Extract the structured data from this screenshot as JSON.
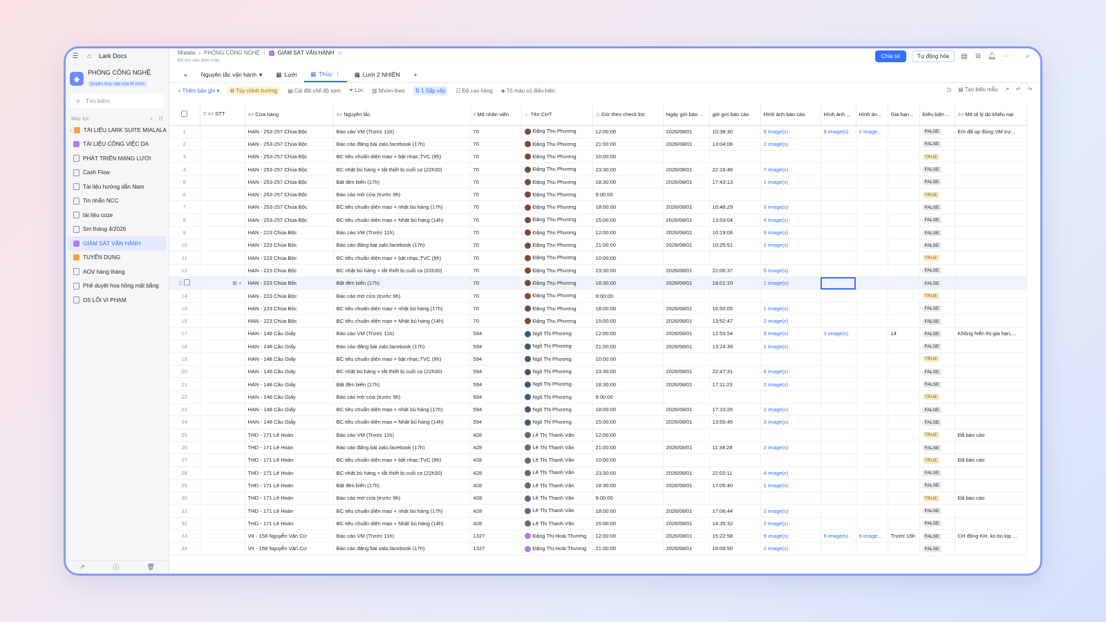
{
  "sidebar": {
    "home_label": "Lark Docs",
    "space_name": "PHÒNG CÔNG NGHỆ",
    "space_sub": "Quyền truy cập của tổ chức",
    "search_placeholder": "Tìm kiếm",
    "section_label": "Mục lục",
    "items": [
      {
        "label": "TÀI LIỆU LARK SUITE MIALALA",
        "kind": "sq",
        "color": "#f5a04a"
      },
      {
        "label": "TÀI LIỆU CÔNG VIỆC DA",
        "kind": "sq",
        "color": "#b47be8"
      },
      {
        "label": "PHÁT TRIỂN MẠNG LƯỚI",
        "kind": "doc"
      },
      {
        "label": "Cash Flow",
        "kind": "doc"
      },
      {
        "label": "Tài liệu hướng dẫn Nam",
        "kind": "doc"
      },
      {
        "label": "Tin nhắn NCC",
        "kind": "doc"
      },
      {
        "label": "tài liệu coze",
        "kind": "doc"
      },
      {
        "label": "Sm tháng 4/2026",
        "kind": "doc"
      },
      {
        "label": "GIÁM SÁT VẬN HÀNH",
        "kind": "sq",
        "color": "#b47be8",
        "active": true
      },
      {
        "label": "TUYỂN DỤNG",
        "kind": "sq",
        "color": "#f5a04a"
      },
      {
        "label": "AOV hàng tháng",
        "kind": "doc"
      },
      {
        "label": "Phê duyệt hoa hồng mặt bằng",
        "kind": "doc"
      },
      {
        "label": "DS LỖI VI PHẠM",
        "kind": "doc"
      }
    ]
  },
  "header": {
    "crumbs": [
      "Mialala",
      "PHÒNG CÔNG NGHỆ",
      "GIÁM SÁT VẬN HÀNH"
    ],
    "saved": "Đã lưu vào đám mây.",
    "share_label": "Chia sẻ",
    "automation_label": "Tự động hóa"
  },
  "tabs": [
    {
      "label": "Nguyên tắc vận hành"
    },
    {
      "label": "Lưới"
    },
    {
      "label": "Thủy",
      "active": true
    },
    {
      "label": "Lưới 2 NHIÊN"
    }
  ],
  "toolbar": {
    "add_record": "Thêm bản ghi",
    "customize": "Tùy chỉnh trường",
    "view_settings": "Cài đặt chế độ xem",
    "filter": "Lọc",
    "group": "Nhóm theo",
    "sort": "1 Sắp xếp",
    "row_height": "Độ cao hàng",
    "conditional_color": "Tô màu có điều kiện",
    "create_form": "Tạo biểu mẫu"
  },
  "columns": [
    "STT",
    "Cửa hàng",
    "Nguyên tắc",
    "Mã nhân viên",
    "Tên CHT",
    "Giờ theo check list",
    "Ngày gửi báo ...",
    "giờ gửi báo cáo",
    "Hình ảnh báo cáo.",
    "Hình ảnh ...",
    "Hình ản...",
    "Gia hạn...",
    "Điều kiện ...",
    "Mô tả lý do khiếu nại"
  ],
  "rows": [
    [
      "1",
      "HAN - 253-257 Chùa Bộc",
      "Báo cáo VM (Trước 11h)",
      "70",
      "Đặng Thu Phương",
      "12:00:00",
      "2026/08/01",
      "10:38:30",
      "9 image(s)",
      "9 image(s)",
      "2 image...",
      "",
      "FALSE",
      "Em đã up đúng VM trư..."
    ],
    [
      "2",
      "HAN - 253-257 Chùa Bộc",
      "Báo cáo đăng bài zalo,facebook (17h)",
      "70",
      "Đặng Thu Phương",
      "21:00:00",
      "2026/08/01",
      "13:04:06",
      "2 image(s)",
      "",
      "",
      "",
      "FALSE",
      ""
    ],
    [
      "3",
      "HAN - 253-257 Chùa Bộc",
      "BC tiêu chuẩn diện mạo + bật nhạc,TVC (9h)",
      "70",
      "Đặng Thu Phương",
      "10:00:00",
      "",
      "",
      "",
      "",
      "",
      "",
      "TRUE",
      ""
    ],
    [
      "4",
      "HAN - 253-257 Chùa Bộc",
      "BC nhặt bù hàng + tắt thiết bị cuối ca (22h30)",
      "70",
      "Đặng Thu Phương",
      "23:30:00",
      "2026/08/01",
      "22:16:46",
      "7 image(s)",
      "",
      "",
      "",
      "FALSE",
      ""
    ],
    [
      "5",
      "HAN - 253-257 Chùa Bộc",
      "Bật đèn biển (17h)",
      "70",
      "Đặng Thu Phương",
      "18:30:00",
      "2026/08/01",
      "17:43:13",
      "1 image(s)",
      "",
      "",
      "",
      "FALSE",
      ""
    ],
    [
      "6",
      "HAN - 253-257 Chùa Bộc",
      "Báo cáo mở cửa (trước 9h)",
      "70",
      "Đặng Thu Phương",
      "9:00:00",
      "",
      "",
      "",
      "",
      "",
      "",
      "TRUE",
      ""
    ],
    [
      "7",
      "HAN - 253-257 Chùa Bộc",
      "BC tiêu chuẩn diện mạo + nhặt bù hàng (17h)",
      "70",
      "Đặng Thu Phương",
      "18:00:00",
      "2026/08/01",
      "16:48:29",
      "3 image(s)",
      "",
      "",
      "",
      "FALSE",
      ""
    ],
    [
      "8",
      "HAN - 253-257 Chùa Bộc",
      "BC tiêu chuẩn diện mạo + Nhặt bù hàng (14h)",
      "70",
      "Đặng Thu Phương",
      "15:00:00",
      "2026/08/01",
      "13:53:04",
      "4 image(s)",
      "",
      "",
      "",
      "FALSE",
      ""
    ],
    [
      "9",
      "HAN - 223 Chùa Bộc",
      "Báo cáo VM (Trước 11h)",
      "70",
      "Đặng Thu Phương",
      "12:00:00",
      "2026/08/01",
      "10:19:06",
      "9 image(s)",
      "",
      "",
      "",
      "FALSE",
      ""
    ],
    [
      "10",
      "HAN - 223 Chùa Bộc",
      "Báo cáo đăng bài zalo,facebook (17h)",
      "70",
      "Đặng Thu Phương",
      "21:00:00",
      "2026/08/01",
      "10:25:51",
      "2 image(s)",
      "",
      "",
      "",
      "FALSE",
      ""
    ],
    [
      "11",
      "HAN - 223 Chùa Bộc",
      "BC tiêu chuẩn diện mạo + bật nhạc,TVC (9h)",
      "70",
      "Đặng Thu Phương",
      "10:00:00",
      "",
      "",
      "",
      "",
      "",
      "",
      "TRUE",
      ""
    ],
    [
      "12",
      "HAN - 223 Chùa Bộc",
      "BC nhặt bù hàng + tắt thiết bị cuối ca (22h30)",
      "70",
      "Đặng Thu Phương",
      "23:30:00",
      "2026/08/01",
      "22:06:37",
      "5 image(s)",
      "",
      "",
      "",
      "FALSE",
      ""
    ],
    [
      "",
      "HAN - 223 Chùa Bộc",
      "Bật đèn biển (17h)",
      "70",
      "Đặng Thu Phương",
      "18:30:00",
      "2026/08/01",
      "18:01:10",
      "1 image(s)",
      "",
      "",
      "",
      "FALSE",
      ""
    ],
    [
      "14",
      "HAN - 223 Chùa Bộc",
      "Báo cáo mở cửa (trước 9h)",
      "70",
      "Đặng Thu Phương",
      "9:00:00",
      "",
      "",
      "",
      "",
      "",
      "",
      "TRUE",
      ""
    ],
    [
      "15",
      "HAN - 223 Chùa Bộc",
      "BC tiêu chuẩn diện mạo + nhặt bù hàng (17h)",
      "70",
      "Đặng Thu Phương",
      "18:00:00",
      "2026/08/01",
      "16:50:05",
      "1 image(s)",
      "",
      "",
      "",
      "FALSE",
      ""
    ],
    [
      "16",
      "HAN - 223 Chùa Bộc",
      "BC tiêu chuẩn diện mạo + Nhặt bù hàng (14h)",
      "70",
      "Đặng Thu Phương",
      "15:00:00",
      "2026/08/01",
      "13:52:47",
      "2 image(s)",
      "",
      "",
      "",
      "FALSE",
      ""
    ],
    [
      "17",
      "HAN - 148 Cầu Giấy",
      "Báo cáo VM (Trước 11h)",
      "594",
      "Ngô Thị Phương",
      "12:00:00",
      "2026/08/01",
      "12:53:54",
      "9 image(s)",
      "3 image(s)",
      "",
      "14",
      "FALSE",
      "Không hiển thị gia hạn,..."
    ],
    [
      "18",
      "HAN - 148 Cầu Giấy",
      "Báo cáo đăng bài zalo,facebook (17h)",
      "594",
      "Ngô Thị Phương",
      "21:00:00",
      "2026/08/01",
      "13:14:39",
      "2 image(s)",
      "",
      "",
      "",
      "FALSE",
      ""
    ],
    [
      "19",
      "HAN - 148 Cầu Giấy",
      "BC tiêu chuẩn diện mạo + bật nhạc,TVC (9h)",
      "594",
      "Ngô Thị Phương",
      "10:00:00",
      "",
      "",
      "",
      "",
      "",
      "",
      "TRUE",
      ""
    ],
    [
      "20",
      "HAN - 148 Cầu Giấy",
      "BC nhặt bù hàng + tắt thiết bị cuối ca (22h30)",
      "594",
      "Ngô Thị Phương",
      "23:30:00",
      "2026/08/01",
      "22:47:31",
      "6 image(s)",
      "",
      "",
      "",
      "FALSE",
      ""
    ],
    [
      "21",
      "HAN - 148 Cầu Giấy",
      "Bật đèn biển (17h)",
      "594",
      "Ngô Thị Phương",
      "18:30:00",
      "2026/08/01",
      "17:11:23",
      "2 image(s)",
      "",
      "",
      "",
      "FALSE",
      ""
    ],
    [
      "22",
      "HAN - 148 Cầu Giấy",
      "Báo cáo mở cửa (trước 9h)",
      "594",
      "Ngô Thị Phương",
      "9:00:00",
      "",
      "",
      "",
      "",
      "",
      "",
      "TRUE",
      ""
    ],
    [
      "23",
      "HAN - 148 Cầu Giấy",
      "BC tiêu chuẩn diện mạo + nhặt bù hàng (17h)",
      "594",
      "Ngô Thị Phương",
      "18:00:00",
      "2026/08/01",
      "17:10:26",
      "2 image(s)",
      "",
      "",
      "",
      "FALSE",
      ""
    ],
    [
      "24",
      "HAN - 148 Cầu Giấy",
      "BC tiêu chuẩn diện mạo + Nhặt bù hàng (14h)",
      "594",
      "Ngô Thị Phương",
      "15:00:00",
      "2026/08/01",
      "13:55:45",
      "3 image(s)",
      "",
      "",
      "",
      "FALSE",
      ""
    ],
    [
      "25",
      "THD - 171 Lê Hoàn",
      "Báo cáo VM (Trước 11h)",
      "428",
      "Lê Thị Thanh Vân",
      "12:00:00",
      "",
      "",
      "",
      "",
      "",
      "",
      "TRUE",
      "Đã báo cáo"
    ],
    [
      "26",
      "THD - 171 Lê Hoàn",
      "Báo cáo đăng bài zalo,facebook (17h)",
      "428",
      "Lê Thị Thanh Vân",
      "21:00:00",
      "2026/08/01",
      "11:34:28",
      "2 image(s)",
      "",
      "",
      "",
      "FALSE",
      ""
    ],
    [
      "27",
      "THD - 171 Lê Hoàn",
      "BC tiêu chuẩn diện mạo + bật nhạc,TVC (9h)",
      "428",
      "Lê Thị Thanh Vân",
      "10:00:00",
      "",
      "",
      "",
      "",
      "",
      "",
      "TRUE",
      "Đã báo cáo"
    ],
    [
      "28",
      "THD - 171 Lê Hoàn",
      "BC nhặt bù hàng + tắt thiết bị cuối ca (22h30)",
      "428",
      "Lê Thị Thanh Vân",
      "23:30:00",
      "2026/08/01",
      "22:02:11",
      "4 image(s)",
      "",
      "",
      "",
      "FALSE",
      ""
    ],
    [
      "29",
      "THD - 171 Lê Hoàn",
      "Bật đèn biển (17h)",
      "428",
      "Lê Thị Thanh Vân",
      "18:30:00",
      "2026/08/01",
      "17:05:40",
      "1 image(s)",
      "",
      "",
      "",
      "FALSE",
      ""
    ],
    [
      "30",
      "THD - 171 Lê Hoàn",
      "Báo cáo mở cửa (trước 9h)",
      "428",
      "Lê Thị Thanh Vân",
      "9:00:00",
      "",
      "",
      "",
      "",
      "",
      "",
      "TRUE",
      "Đã báo cáo"
    ],
    [
      "31",
      "THD - 171 Lê Hoàn",
      "BC tiêu chuẩn diện mạo + nhặt bù hàng (17h)",
      "428",
      "Lê Thị Thanh Vân",
      "18:00:00",
      "2026/08/01",
      "17:06:44",
      "2 image(s)",
      "",
      "",
      "",
      "FALSE",
      ""
    ],
    [
      "32",
      "THD - 171 Lê Hoàn",
      "BC tiêu chuẩn diện mạo + Nhặt bù hàng (14h)",
      "428",
      "Lê Thị Thanh Vân",
      "15:00:00",
      "2026/08/01",
      "14:35:32",
      "2 image(s)",
      "",
      "",
      "",
      "FALSE",
      ""
    ],
    [
      "33",
      "VII - 158 Nguyễn Văn Cừ",
      "Báo cáo VM (Trước 11h)",
      "1327",
      "Đặng Thị Hoài Thương",
      "12:00:00",
      "2026/08/01",
      "15:22:58",
      "9 image(s)",
      "9 image(s)",
      "9 image...",
      "Trước 16h",
      "FALSE",
      "CH đông KH, ko bù kịp ..."
    ],
    [
      "34",
      "VII - 158 Nguyễn Văn Cừ",
      "Báo cáo đăng bài zalo,facebook (17h)",
      "1327",
      "Đặng Thị Hoài Thương",
      "21:00:00",
      "2026/08/01",
      "16:09:50",
      "2 image(s)",
      "",
      "",
      "",
      "FALSE",
      ""
    ]
  ]
}
